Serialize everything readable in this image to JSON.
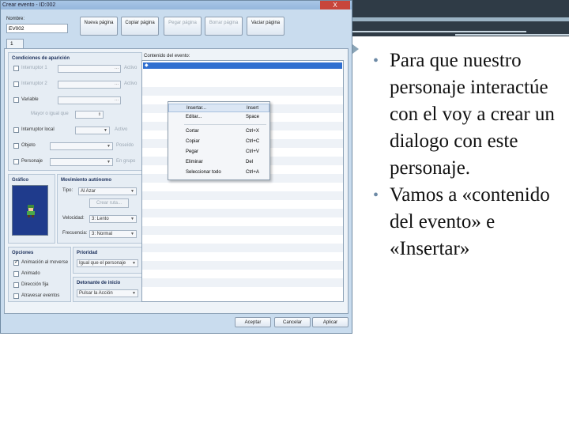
{
  "window": {
    "title": "Crear evento - ID:002",
    "close": "X"
  },
  "name_label": "Nombre:",
  "name_value": "EV002",
  "top_buttons": [
    {
      "label": "Nueva página",
      "enabled": true
    },
    {
      "label": "Copiar página",
      "enabled": true
    },
    {
      "label": "Pegar página",
      "enabled": false
    },
    {
      "label": "Borrar página",
      "enabled": false
    },
    {
      "label": "Vaciar página",
      "enabled": true
    }
  ],
  "tab": "1",
  "conditions": {
    "title": "Condiciones de aparición",
    "rows": [
      {
        "label": "Interruptor 1",
        "suffix": "Activo"
      },
      {
        "label": "Interruptor 2",
        "suffix": "Activo"
      },
      {
        "label": "Variable",
        "suffix": ""
      },
      {
        "label": "Mayor o igual que",
        "suffix": ""
      },
      {
        "label": "Interruptor local",
        "suffix": "Activo"
      },
      {
        "label": "Objeto",
        "suffix": "Poseído"
      },
      {
        "label": "Personaje",
        "suffix": "En grupo"
      }
    ]
  },
  "content": {
    "title": "Contenido del evento:",
    "first_row": "◆"
  },
  "context_menu": [
    {
      "label": "Insertar...",
      "shortcut": "Insert",
      "state": "highlight"
    },
    {
      "label": "Editar...",
      "shortcut": "Space",
      "state": "normal"
    },
    {
      "label": "Cortar",
      "shortcut": "Ctrl+X",
      "state": "normal"
    },
    {
      "label": "Copiar",
      "shortcut": "Ctrl+C",
      "state": "normal"
    },
    {
      "label": "Pegar",
      "shortcut": "Ctrl+V",
      "state": "normal"
    },
    {
      "label": "Eliminar",
      "shortcut": "Del",
      "state": "normal"
    },
    {
      "label": "Seleccionar todo",
      "shortcut": "Ctrl+A",
      "state": "normal"
    }
  ],
  "graphic": {
    "title": "Gráfico"
  },
  "movement": {
    "title": "Movimiento autónomo",
    "type_label": "Tipo:",
    "type_value": "Al Azar",
    "route_btn": "Crear ruta...",
    "speed_label": "Velocidad:",
    "speed_value": "3: Lento",
    "freq_label": "Frecuencia:",
    "freq_value": "3: Normal"
  },
  "options": {
    "title": "Opciones",
    "items": [
      {
        "label": "Animación al moverse",
        "checked": true
      },
      {
        "label": "Animado",
        "checked": false
      },
      {
        "label": "Dirección fija",
        "checked": false
      },
      {
        "label": "Atravesar eventos",
        "checked": false
      }
    ]
  },
  "priority": {
    "title": "Prioridad",
    "value": "Igual que el personaje"
  },
  "trigger": {
    "title": "Detonante de inicio",
    "value": "Pulsar la Acción"
  },
  "bottom_buttons": [
    "Aceptar",
    "Cancelar",
    "Aplicar"
  ],
  "slide_bullets": [
    "Para que nuestro personaje interactúe con el voy a crear un dialogo con este personaje.",
    "Vamos a «contenido del evento» e «Insertar»"
  ],
  "colors": {
    "accent": "#2f6fd0",
    "slide_bar": "#2f3b46",
    "bullet": "#6d8aa6"
  }
}
